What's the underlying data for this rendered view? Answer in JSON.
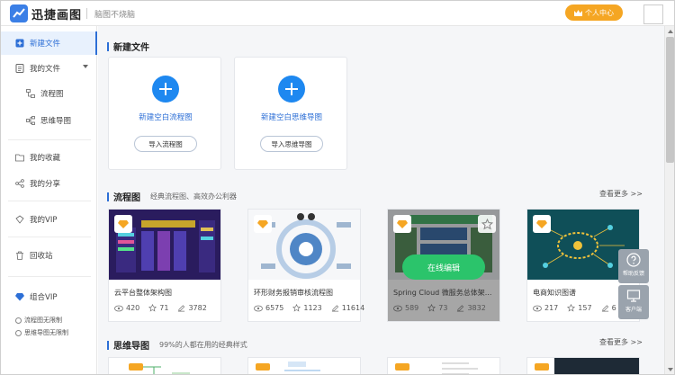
{
  "header": {
    "app_name": "迅捷画图",
    "slogan": "脑图不烧脑",
    "user_center_label": "个人中心"
  },
  "sidebar": {
    "items": [
      {
        "label": "新建文件",
        "icon": "plus-square-icon"
      },
      {
        "label": "我的文件",
        "icon": "file-list-icon"
      },
      {
        "label": "流程图",
        "icon": "flowchart-icon"
      },
      {
        "label": "思维导图",
        "icon": "mindmap-icon"
      },
      {
        "label": "我的收藏",
        "icon": "folder-star-icon"
      },
      {
        "label": "我的分享",
        "icon": "share-icon"
      },
      {
        "label": "我的VIP",
        "icon": "vip-icon"
      },
      {
        "label": "回收站",
        "icon": "trash-icon"
      },
      {
        "label": "组合VIP",
        "icon": "diamond-icon"
      }
    ],
    "vip_notes": [
      "流程图无限制",
      "思维导图无限制"
    ]
  },
  "new_file": {
    "title": "新建文件",
    "cards": [
      {
        "label": "新建空白流程图",
        "import_label": "导入流程图"
      },
      {
        "label": "新建空白思维导图",
        "import_label": "导入思维导图"
      }
    ]
  },
  "flowchart_section": {
    "title": "流程图",
    "subtitle": "经典流程图、高效办公利器",
    "more_label": "查看更多 >>",
    "templates": [
      {
        "name": "云平台整体架构图",
        "views": "420",
        "likes": "71",
        "uses": "3782"
      },
      {
        "name": "环形财务报销审核流程图",
        "views": "6575",
        "likes": "1123",
        "uses": "11614"
      },
      {
        "name": "Spring Cloud 微服务总体架...",
        "views": "589",
        "likes": "73",
        "uses": "3832",
        "hover_label": "在线编辑"
      },
      {
        "name": "电商知识图谱",
        "views": "217",
        "likes": "157",
        "uses": "6"
      }
    ]
  },
  "mindmap_section": {
    "title": "思维导图",
    "subtitle": "99%的人都在用的经典样式",
    "more_label": "查看更多 >>"
  },
  "float_buttons": {
    "help_label": "帮助反馈",
    "client_label": "客户端"
  },
  "colors": {
    "accent": "#2d6fd6",
    "plus": "#1e88f0",
    "user_button": "#f5a623",
    "edit_button": "#2bc46b"
  }
}
